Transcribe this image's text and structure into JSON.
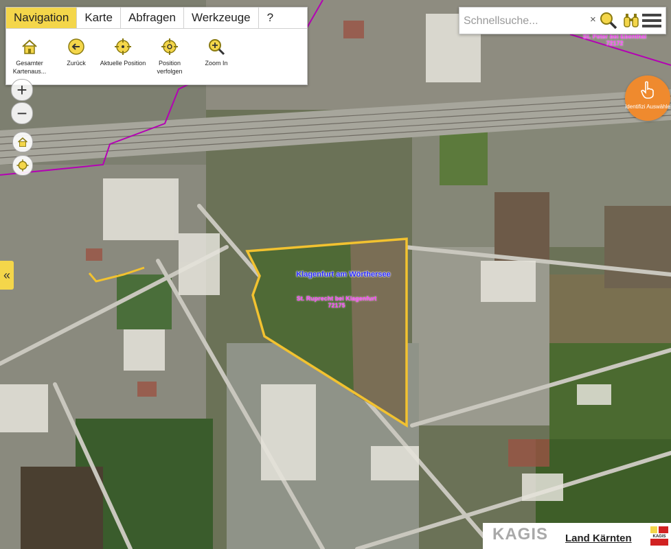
{
  "nav": {
    "tabs": [
      {
        "label": "Navigation",
        "active": true
      },
      {
        "label": "Karte"
      },
      {
        "label": "Abfragen"
      },
      {
        "label": "Werkzeuge"
      },
      {
        "label": "?"
      }
    ],
    "tools": [
      {
        "label": "Gesamter Kartenaus...",
        "icon": "home-icon"
      },
      {
        "label": "Zurück",
        "icon": "arrow-left-icon"
      },
      {
        "label": "Aktuelle Position",
        "icon": "crosshair-icon"
      },
      {
        "label": "Position verfolgen",
        "icon": "crosshair-follow-icon"
      },
      {
        "label": "Zoom In",
        "icon": "zoom-in-icon"
      }
    ]
  },
  "zoom": {
    "in": "+",
    "out": "−"
  },
  "search": {
    "placeholder": "Schnellsuche...",
    "clear": "×"
  },
  "identify": {
    "label": "Identifizi Auswähle"
  },
  "collapse": {
    "label": "«"
  },
  "map_labels": {
    "city": "Klagenfurt am Wörthersee",
    "cadastral_name": "St. Ruprecht bei Klagenfurt",
    "cadastral_number": "72175",
    "corner_name": "St. Peter bei Ebenthal",
    "corner_number": "72172"
  },
  "footer": {
    "brand": "KAGIS",
    "region": "Land Kärnten",
    "logo_text": "KAGIS"
  },
  "colors": {
    "accent": "#f4d64a",
    "identify": "#ef8a2e",
    "parcel": "#f2c230",
    "boundary": "#b400b4",
    "city_label": "#2b2bff",
    "cadastral_label": "#ff3cff"
  }
}
